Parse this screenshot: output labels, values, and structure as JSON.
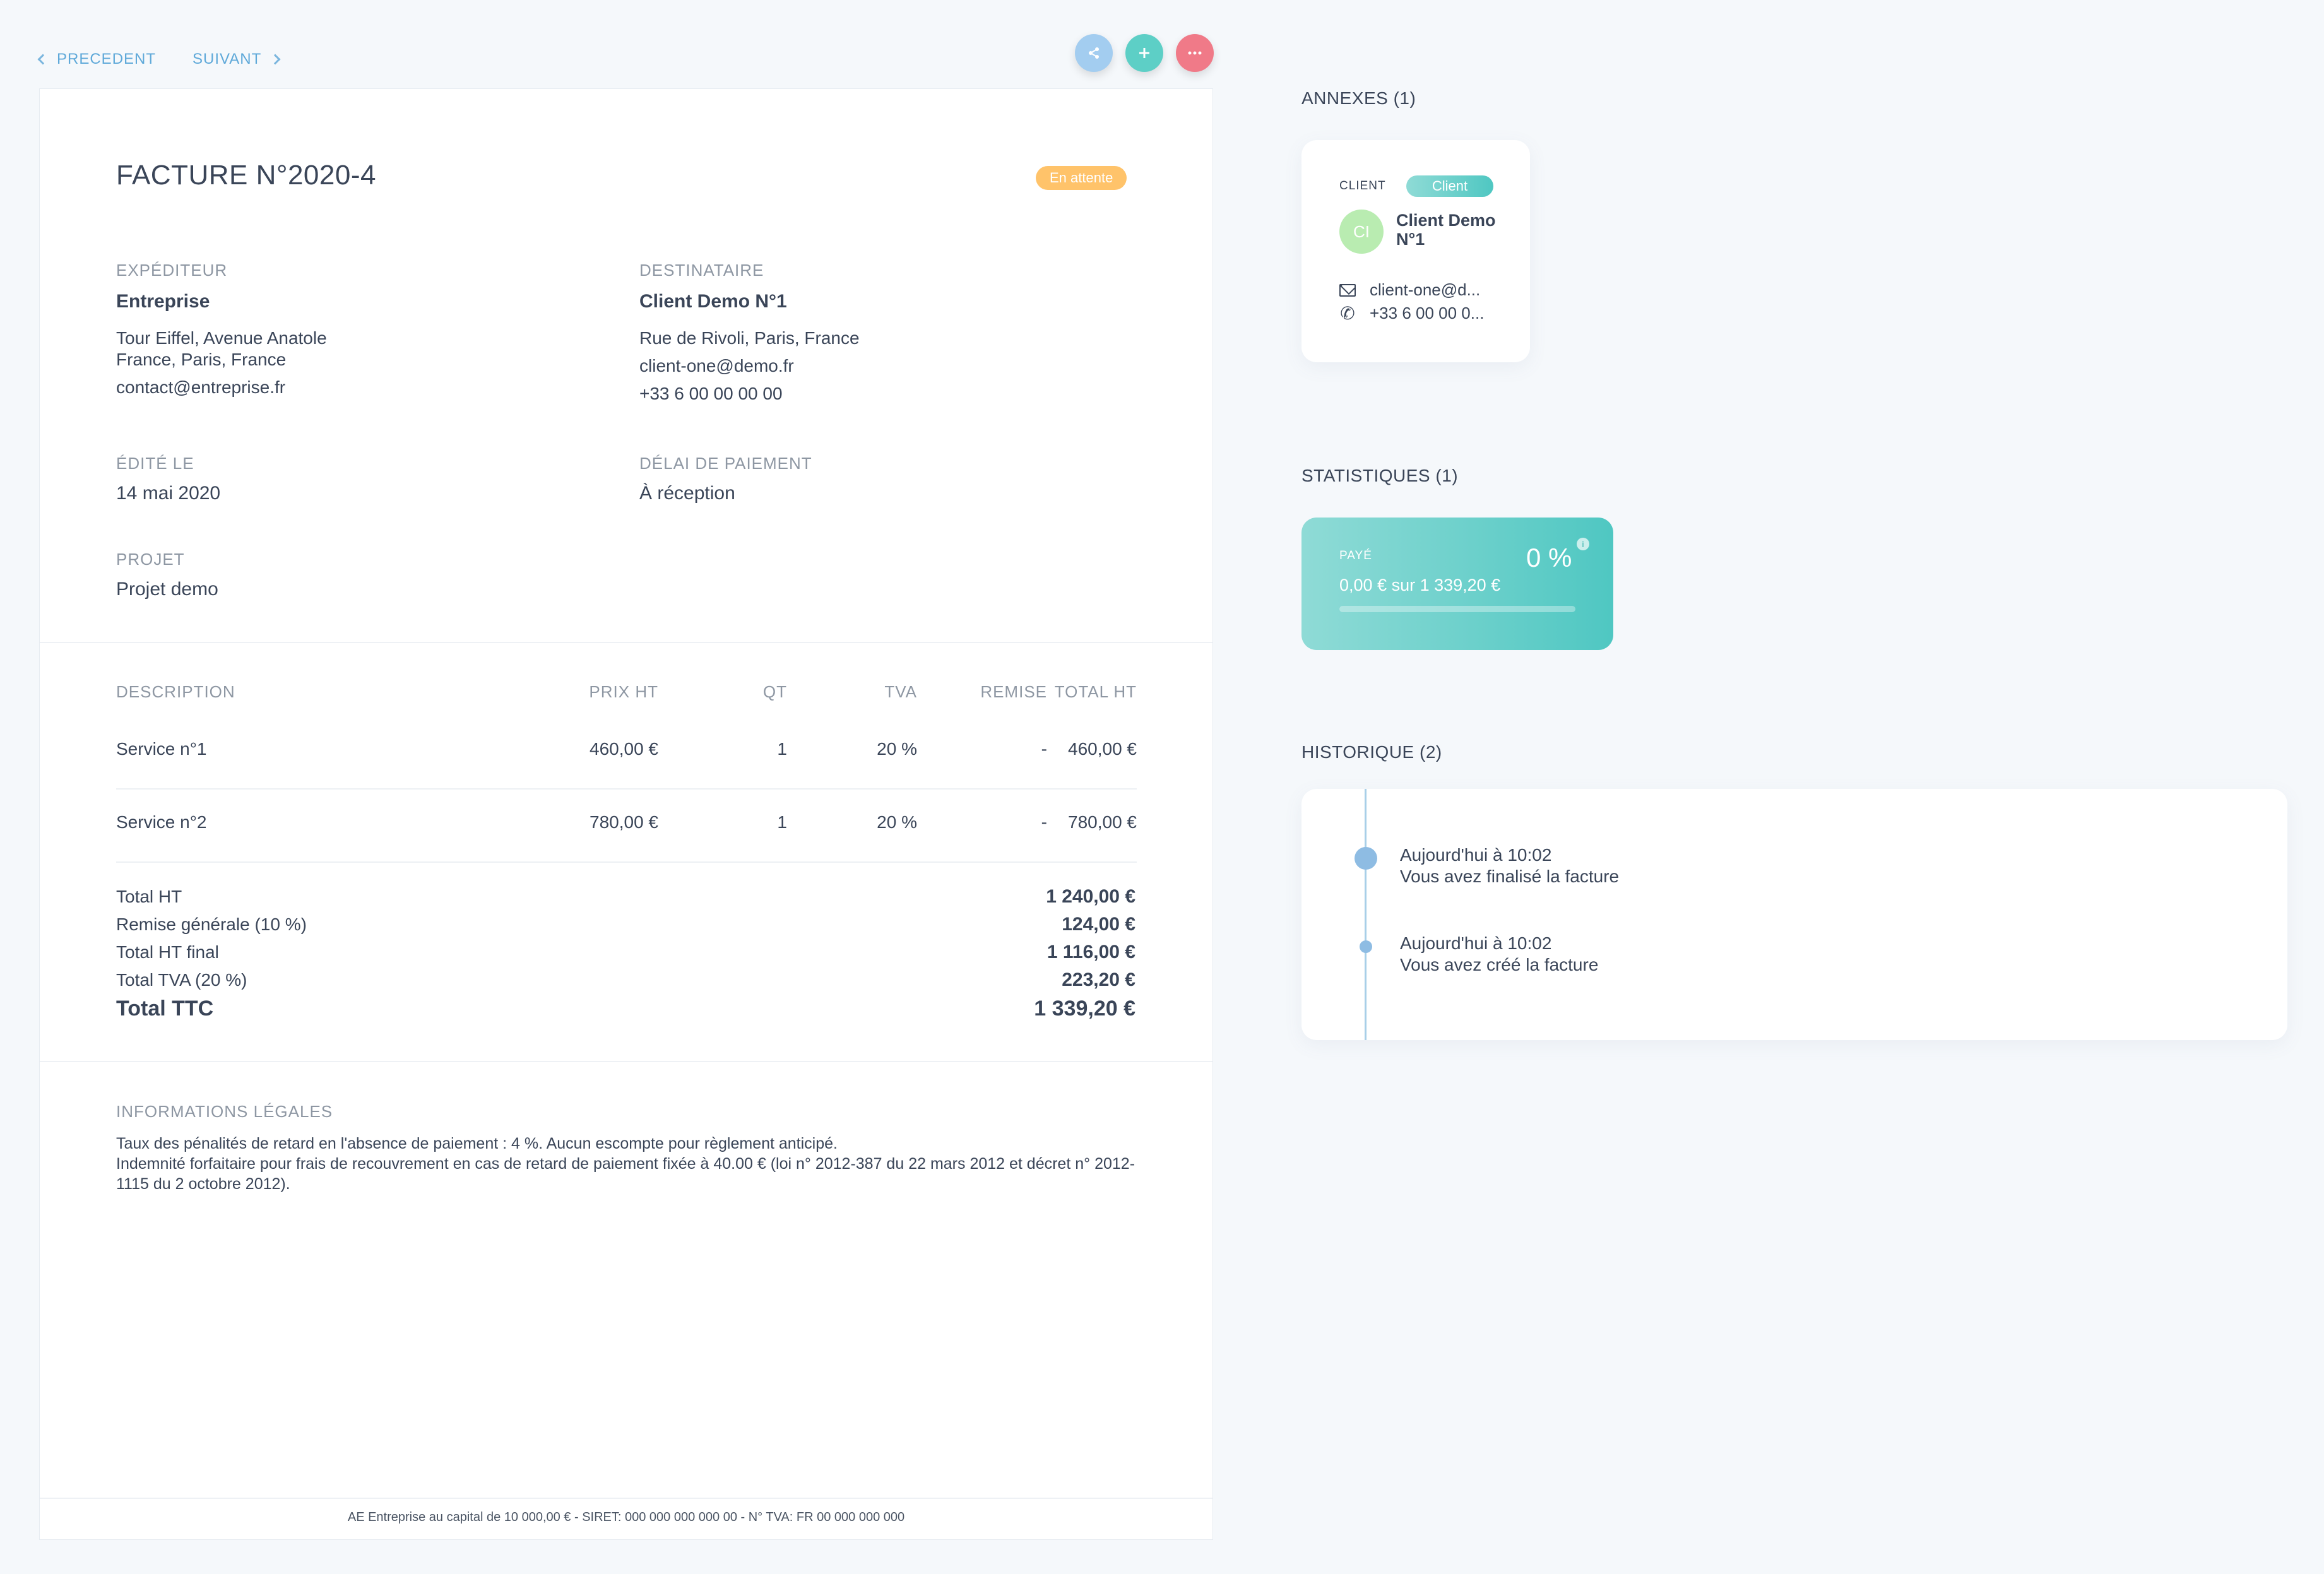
{
  "nav": {
    "prev_label": "PRECEDENT",
    "next_label": "SUIVANT"
  },
  "actions": {
    "share_icon": "share-icon",
    "add_icon": "plus-icon",
    "more_icon": "more-icon"
  },
  "invoice": {
    "title": "FACTURE N°2020-4",
    "status": "En attente",
    "sender": {
      "label": "EXPÉDITEUR",
      "name": "Entreprise",
      "address_line1": "Tour Eiffel, Avenue Anatole",
      "address_line2": "France, Paris, France",
      "email": "contact@entreprise.fr"
    },
    "recipient": {
      "label": "DESTINATAIRE",
      "name": "Client Demo N°1",
      "address": "Rue de Rivoli, Paris, France",
      "email": "client-one@demo.fr",
      "phone": "+33 6 00 00 00 00"
    },
    "edited": {
      "label": "ÉDITÉ LE",
      "value": "14 mai 2020"
    },
    "payment_delay": {
      "label": "DÉLAI DE PAIEMENT",
      "value": "À réception"
    },
    "project": {
      "label": "PROJET",
      "value": "Projet demo"
    },
    "table": {
      "headers": {
        "description": "DESCRIPTION",
        "price": "PRIX HT",
        "qty": "QT",
        "vat": "TVA",
        "discount": "REMISE",
        "total": "TOTAL HT"
      },
      "rows": [
        {
          "description": "Service n°1",
          "price": "460,00 €",
          "qty": "1",
          "vat": "20 %",
          "discount": "-",
          "total": "460,00 €"
        },
        {
          "description": "Service n°2",
          "price": "780,00 €",
          "qty": "1",
          "vat": "20 %",
          "discount": "-",
          "total": "780,00 €"
        }
      ]
    },
    "totals": [
      {
        "label": "Total HT",
        "value": "1 240,00 €"
      },
      {
        "label": "Remise générale (10 %)",
        "value": "124,00 €"
      },
      {
        "label": "Total HT final",
        "value": "1 116,00 €"
      },
      {
        "label": "Total TVA (20 %)",
        "value": "223,20 €"
      },
      {
        "label": "Total TTC",
        "value": "1 339,20 €"
      }
    ],
    "legal": {
      "label": "INFORMATIONS LÉGALES",
      "line1": "Taux des pénalités de retard en l'absence de paiement : 4 %. Aucun escompte pour règlement anticipé.",
      "line2": "Indemnité forfaitaire pour frais de recouvrement en cas de retard de paiement fixée à 40.00 € (loi n° 2012-387 du 22 mars 2012 et décret n° 2012-1115 du 2 octobre 2012)."
    },
    "footer": "AE Entreprise au capital de 10 000,00 € - SIRET: 000 000 000 000 00 - N° TVA: FR 00 000 000 000"
  },
  "annexes": {
    "title": "ANNEXES (1)",
    "client_label": "CLIENT",
    "client_badge": "Client",
    "avatar_initials": "CI",
    "name": "Client Demo N°1",
    "email": "client-one@d...",
    "phone": "+33 6 00 00 0..."
  },
  "stats": {
    "title": "STATISTIQUES (1)",
    "label": "PAYÉ",
    "percent": "0 %",
    "percent_value": 0,
    "info": "i",
    "summary": "0,00 € sur  1 339,20 €"
  },
  "history": {
    "title": "HISTORIQUE (2)",
    "items": [
      {
        "time": "Aujourd'hui à 10:02",
        "text": "Vous avez finalisé la facture"
      },
      {
        "time": "Aujourd'hui à 10:02",
        "text": "Vous avez créé la facture"
      }
    ]
  },
  "colors": {
    "accent": "#5fa9d9",
    "teal": "#4fc7c2",
    "status": "#ffc36a",
    "danger": "#f07a88"
  }
}
